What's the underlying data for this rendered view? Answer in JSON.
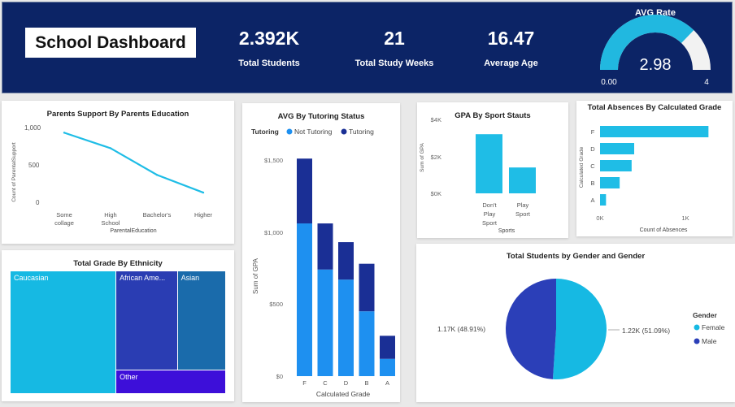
{
  "header": {
    "title": "School Dashboard",
    "kpis": [
      {
        "value": "2.392K",
        "label": "Total Students"
      },
      {
        "value": "21",
        "label": "Total Study Weeks"
      },
      {
        "value": "16.47",
        "label": "Average Age"
      }
    ],
    "gauge": {
      "title": "AVG Rate",
      "value": "2.98",
      "min_label": "0.00",
      "max_label": "4",
      "value_num": 2.98,
      "min": 0,
      "max": 4,
      "fill_color": "#21b8e0",
      "track_color": "#f2f2f2"
    }
  },
  "colors": {
    "header_bg": "#0c2466",
    "accent": "#1fbde6",
    "tutoring": "#1a2f95",
    "not_tutoring": "#1e90f0",
    "male": "#2b3fb8",
    "female": "#16b9e3"
  },
  "charts": {
    "parents": {
      "title": "Parents Support By Parents Education",
      "ylabel": "Count of ParentalSupport",
      "xlabel": "ParentalEducation",
      "ytick_labels": [
        "1,000",
        "500",
        "0"
      ],
      "category_labels": [
        [
          "Some",
          "collage"
        ],
        [
          "High",
          "School"
        ],
        [
          "Bachelor's"
        ],
        [
          "Higher"
        ]
      ]
    },
    "tutoring": {
      "title": "AVG By Tutoring Status",
      "legend_title": "Tutoring",
      "legend": [
        "Not Tutoring",
        "Tutoring"
      ],
      "ylabel": "Sum of GPA",
      "xlabel": "Calculated Grade",
      "ytick_labels": [
        "$1,500",
        "$1,000",
        "$500",
        "$0"
      ]
    },
    "sport": {
      "title": "GPA By Sport Stauts",
      "ylabel": "Sum of GPA",
      "xlabel": "Sports",
      "ytick_labels": [
        "$4K",
        "$2K",
        "$0K"
      ],
      "category_labels": [
        [
          "Don't",
          "Play",
          "Sport"
        ],
        [
          "Play",
          "Sport"
        ]
      ]
    },
    "absences": {
      "title": "Total Absences By Calculated Grade",
      "ylabel": "Calculated Grade",
      "xlabel": "Count of Absences",
      "xtick_labels": [
        "0K",
        "1K"
      ]
    },
    "ethnicity": {
      "title": "Total Grade By Ethnicity",
      "labels": [
        "Caucasian",
        "African Ame...",
        "Asian",
        "Other"
      ]
    },
    "gender": {
      "title": "Total Students by Gender and Gender",
      "legend_title": "Gender",
      "legend": [
        "Female",
        "Male"
      ],
      "slice_labels": [
        "1.22K (51.09%)",
        "1.17K (48.91%)"
      ]
    }
  },
  "chart_data": [
    {
      "type": "line",
      "title": "Parents Support By Parents Education",
      "categories": [
        "Some collage",
        "High School",
        "Bachelor's",
        "Higher"
      ],
      "values": [
        930,
        720,
        360,
        120
      ],
      "xlabel": "ParentalEducation",
      "ylabel": "Count of ParentalSupport",
      "ylim": [
        0,
        1000
      ],
      "color": "#1fbde6"
    },
    {
      "type": "bar",
      "stacked": true,
      "title": "AVG By Tutoring Status",
      "categories": [
        "F",
        "C",
        "D",
        "B",
        "A"
      ],
      "series": [
        {
          "name": "Not Tutoring",
          "values": [
            1060,
            740,
            670,
            450,
            120
          ],
          "color": "#1e90f0"
        },
        {
          "name": "Tutoring",
          "values": [
            450,
            320,
            260,
            330,
            160
          ],
          "color": "#1a2f95"
        }
      ],
      "xlabel": "Calculated Grade",
      "ylabel": "Sum of GPA",
      "ylim": [
        0,
        1500
      ]
    },
    {
      "type": "bar",
      "title": "GPA By Sport Stauts",
      "categories": [
        "Don't Play Sport",
        "Play Sport"
      ],
      "values": [
        3200,
        1400
      ],
      "xlabel": "Sports",
      "ylabel": "Sum of GPA",
      "ylim": [
        0,
        4000
      ],
      "color": "#1fbde6"
    },
    {
      "type": "bar",
      "orientation": "horizontal",
      "title": "Total Absences By Calculated Grade",
      "categories": [
        "F",
        "D",
        "C",
        "B",
        "A"
      ],
      "values": [
        1270,
        400,
        370,
        230,
        70
      ],
      "xlabel": "Count of Absences",
      "ylabel": "Calculated Grade",
      "xlim": [
        0,
        1300
      ],
      "color": "#1fbde6"
    },
    {
      "type": "treemap",
      "title": "Total Grade By Ethnicity",
      "categories": [
        "Caucasian",
        "African Ame...",
        "Asian",
        "Other"
      ],
      "values": [
        2700,
        1270,
        1000,
        530
      ],
      "colors": [
        "#16b9e3",
        "#2a3db3",
        "#1a6bab",
        "#3d0fd9"
      ]
    },
    {
      "type": "pie",
      "title": "Total Students by Gender and Gender",
      "categories": [
        "Female",
        "Male"
      ],
      "values": [
        1220,
        1170
      ],
      "percents": [
        51.09,
        48.91
      ],
      "colors": [
        "#16b9e3",
        "#2b3fb8"
      ]
    }
  ]
}
